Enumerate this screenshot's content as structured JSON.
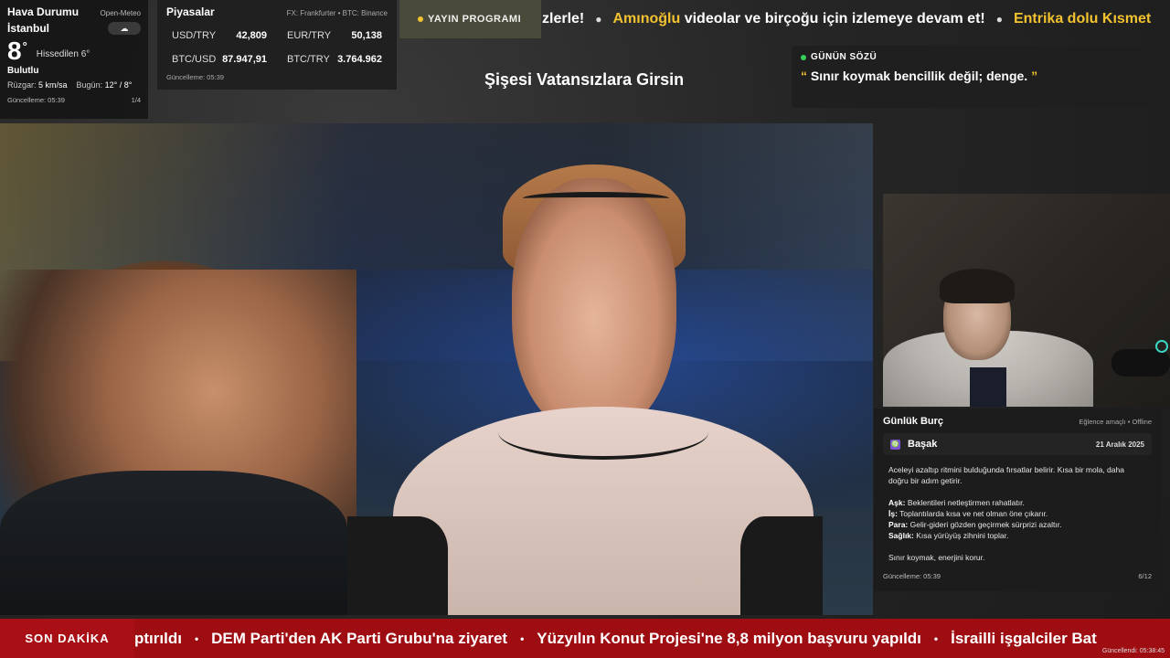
{
  "weather": {
    "title": "Hava Durumu",
    "source": "Open-Meteo",
    "city": "İstanbul",
    "icon": "cloud-icon",
    "icon_glyph": "☁",
    "temp": "8",
    "temp_unit": "°",
    "feels_like": "Hissedilen 6°",
    "condition": "Bulutlu",
    "wind_label": "Rüzgar:",
    "wind_value": "5 km/sa",
    "today_label": "Bugün:",
    "today_value": "12° / 8°",
    "updated": "Güncelleme: 05:39",
    "page": "1/4"
  },
  "markets": {
    "title": "Piyasalar",
    "source": "FX: Frankfurter • BTC: Binance",
    "items": [
      {
        "symbol": "USD/TRY",
        "value": "42,809"
      },
      {
        "symbol": "EUR/TRY",
        "value": "50,138"
      },
      {
        "symbol": "BTC/USD",
        "value": "87.947,91"
      },
      {
        "symbol": "BTC/TRY",
        "value": "3.764.962"
      }
    ],
    "updated": "Güncelleme: 05:39"
  },
  "program_button": {
    "label": "YAYIN PROGRAMI"
  },
  "top_ticker": {
    "items": [
      {
        "pre": "",
        "highlight": "",
        "post": "zlerle!"
      },
      {
        "pre": "",
        "highlight": "Amınoğlu",
        "post": " videolar ve birçoğu için izlemeye devam et!"
      },
      {
        "pre": "",
        "highlight": "Entrika dolu Kısmet",
        "post": ""
      }
    ]
  },
  "stream_title": "Şişesi Vatansızlara Girsin",
  "quote": {
    "title": "GÜNÜN SÖZÜ",
    "open_mark": "“",
    "text": "Sınır koymak bencillik değil; denge.",
    "close_mark": "”"
  },
  "horoscope": {
    "title": "Günlük Burç",
    "tag": "Eğlence amaçlı • Offline",
    "sign_icon_glyph": "♍",
    "sign": "Başak",
    "date": "21 Aralık 2025",
    "intro": "Aceleyi azaltıp ritmini bulduğunda fırsatlar belirir. Kısa bir mola, daha doğru bir adım getirir.",
    "love_label": "Aşk:",
    "love_text": "Beklentileri netleştirmen rahatlatır.",
    "work_label": "İş:",
    "work_text": "Toplantılarda kısa ve net olman öne çıkarır.",
    "money_label": "Para:",
    "money_text": "Gelir-gideri gözden geçirmek sürprizi azaltır.",
    "health_label": "Sağlık:",
    "health_text": "Kısa yürüyüş zihnini toplar.",
    "closing": "Sınır koymak, enerjini korur.",
    "updated": "Güncelleme: 05:39",
    "page": "6/12"
  },
  "breaking": {
    "label": "SON DAKİKA",
    "items": [
      "ptırıldı",
      "DEM Parti'den AK Parti Grubu'na ziyaret",
      "Yüzyılın Konut Projesi'ne 8,8 milyon başvuru yapıldı",
      "İsrailli işgalciler Bat"
    ],
    "separator": "•",
    "updated": "Güncellendi: 05:38:45"
  },
  "colors": {
    "accent_yellow": "#f2c230",
    "breaking_red": "#9e0d12",
    "status_green": "#35d05a"
  }
}
